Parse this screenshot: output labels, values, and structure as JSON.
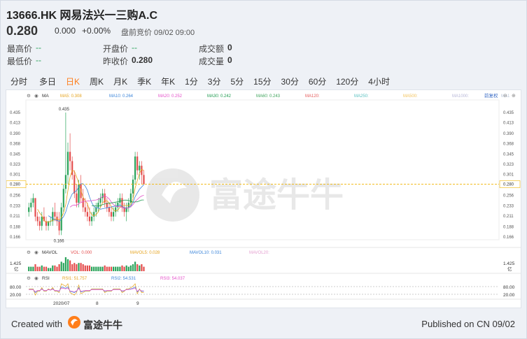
{
  "header": {
    "title": "13666.HK 网易法兴一三购A.C",
    "price": "0.280",
    "change": "0.000",
    "change_pct": "+0.00%",
    "premarket": "盘前竞价 09/02 09:00"
  },
  "stats": [
    {
      "label": "最高价",
      "value": "--"
    },
    {
      "label": "开盘价",
      "value": "--"
    },
    {
      "label": "成交额",
      "value": "0"
    },
    {
      "label": "最低价",
      "value": "--"
    },
    {
      "label": "昨收价",
      "value": "0.280"
    },
    {
      "label": "成交量",
      "value": "0"
    }
  ],
  "tabs": [
    "分时",
    "多日",
    "日K",
    "周K",
    "月K",
    "季K",
    "年K",
    "1分",
    "3分",
    "5分",
    "15分",
    "30分",
    "60分",
    "120分",
    "4小时"
  ],
  "active_tab": "日K",
  "indicators": {
    "main": "MA",
    "ma_items": [
      {
        "label": "MA5: 0.308",
        "color": "#e5a21b"
      },
      {
        "label": "MA10: 0.264",
        "color": "#3a84d9"
      },
      {
        "label": "MA20: 0.252",
        "color": "#e44ec9"
      },
      {
        "label": "MA30: 0.242",
        "color": "#1d9a4e"
      },
      {
        "label": "MA60: 0.243",
        "color": "#3da35a"
      },
      {
        "label": "MA120:",
        "color": "#e45959"
      },
      {
        "label": "MA250:",
        "color": "#58c0c0"
      },
      {
        "label": "MA500:",
        "color": "#f3c25a"
      },
      {
        "label": "MA1000:",
        "color": "#b7b7d7"
      },
      {
        "label": "MA1",
        "color": "#b7c4d7"
      }
    ],
    "adjust": "前复权",
    "vol": "MAVOL",
    "vol_items": [
      {
        "label": "VOL: 0.000",
        "color": "#e44e4e"
      },
      {
        "label": "MAVOL5: 0.028",
        "color": "#e5a21b"
      },
      {
        "label": "MAVOL10: 0.031",
        "color": "#3a84d9"
      },
      {
        "label": "MAVOL20:",
        "color": "#e4a0d0"
      }
    ],
    "rsi": "RSI",
    "rsi_items": [
      {
        "label": "RSI1: 51.757",
        "color": "#e5a21b"
      },
      {
        "label": "RSI2: 54.531",
        "color": "#3a84d9"
      },
      {
        "label": "RSI3: 54.037",
        "color": "#e44ec9"
      }
    ]
  },
  "chart_data": {
    "type": "candlestick",
    "y_ticks": [
      "0.435",
      "0.413",
      "0.390",
      "0.368",
      "0.345",
      "0.323",
      "0.301",
      "0.280",
      "0.256",
      "0.233",
      "0.211",
      "0.188",
      "0.166"
    ],
    "ylim": [
      0.166,
      0.435
    ],
    "last_price": "0.280",
    "high_label": "0.435",
    "low_label": "0.166",
    "x_labels": [
      "2020/07",
      "8",
      "9"
    ],
    "vol_ticks": [
      "1.425",
      "亿"
    ],
    "rsi_ticks": [
      "80.00",
      "20.00"
    ],
    "candles": [
      {
        "o": 0.22,
        "h": 0.24,
        "l": 0.21,
        "c": 0.23
      },
      {
        "o": 0.23,
        "h": 0.25,
        "l": 0.22,
        "c": 0.24
      },
      {
        "o": 0.24,
        "h": 0.26,
        "l": 0.23,
        "c": 0.25
      },
      {
        "o": 0.25,
        "h": 0.25,
        "l": 0.2,
        "c": 0.21
      },
      {
        "o": 0.21,
        "h": 0.22,
        "l": 0.19,
        "c": 0.2
      },
      {
        "o": 0.2,
        "h": 0.21,
        "l": 0.18,
        "c": 0.19
      },
      {
        "o": 0.19,
        "h": 0.22,
        "l": 0.18,
        "c": 0.21
      },
      {
        "o": 0.21,
        "h": 0.23,
        "l": 0.2,
        "c": 0.2
      },
      {
        "o": 0.2,
        "h": 0.21,
        "l": 0.18,
        "c": 0.19
      },
      {
        "o": 0.19,
        "h": 0.2,
        "l": 0.18,
        "c": 0.2
      },
      {
        "o": 0.2,
        "h": 0.21,
        "l": 0.19,
        "c": 0.2
      },
      {
        "o": 0.2,
        "h": 0.23,
        "l": 0.19,
        "c": 0.22
      },
      {
        "o": 0.22,
        "h": 0.24,
        "l": 0.2,
        "c": 0.21
      },
      {
        "o": 0.21,
        "h": 0.22,
        "l": 0.19,
        "c": 0.2
      },
      {
        "o": 0.2,
        "h": 0.22,
        "l": 0.17,
        "c": 0.18
      },
      {
        "o": 0.18,
        "h": 0.24,
        "l": 0.17,
        "c": 0.23
      },
      {
        "o": 0.23,
        "h": 0.28,
        "l": 0.22,
        "c": 0.27
      },
      {
        "o": 0.27,
        "h": 0.435,
        "l": 0.26,
        "c": 0.3
      },
      {
        "o": 0.3,
        "h": 0.37,
        "l": 0.28,
        "c": 0.35
      },
      {
        "o": 0.35,
        "h": 0.39,
        "l": 0.31,
        "c": 0.33
      },
      {
        "o": 0.33,
        "h": 0.34,
        "l": 0.29,
        "c": 0.3
      },
      {
        "o": 0.3,
        "h": 0.31,
        "l": 0.25,
        "c": 0.26
      },
      {
        "o": 0.26,
        "h": 0.28,
        "l": 0.23,
        "c": 0.24
      },
      {
        "o": 0.24,
        "h": 0.29,
        "l": 0.23,
        "c": 0.28
      },
      {
        "o": 0.28,
        "h": 0.3,
        "l": 0.24,
        "c": 0.25
      },
      {
        "o": 0.25,
        "h": 0.27,
        "l": 0.22,
        "c": 0.23
      },
      {
        "o": 0.23,
        "h": 0.25,
        "l": 0.21,
        "c": 0.22
      },
      {
        "o": 0.22,
        "h": 0.24,
        "l": 0.2,
        "c": 0.21
      },
      {
        "o": 0.21,
        "h": 0.23,
        "l": 0.19,
        "c": 0.2
      },
      {
        "o": 0.2,
        "h": 0.22,
        "l": 0.19,
        "c": 0.21
      },
      {
        "o": 0.21,
        "h": 0.23,
        "l": 0.2,
        "c": 0.22
      },
      {
        "o": 0.22,
        "h": 0.24,
        "l": 0.21,
        "c": 0.23
      },
      {
        "o": 0.23,
        "h": 0.25,
        "l": 0.22,
        "c": 0.24
      },
      {
        "o": 0.24,
        "h": 0.26,
        "l": 0.23,
        "c": 0.25
      },
      {
        "o": 0.25,
        "h": 0.27,
        "l": 0.24,
        "c": 0.26
      },
      {
        "o": 0.26,
        "h": 0.27,
        "l": 0.23,
        "c": 0.24
      },
      {
        "o": 0.24,
        "h": 0.25,
        "l": 0.22,
        "c": 0.23
      },
      {
        "o": 0.23,
        "h": 0.24,
        "l": 0.21,
        "c": 0.22
      },
      {
        "o": 0.22,
        "h": 0.23,
        "l": 0.2,
        "c": 0.21
      },
      {
        "o": 0.21,
        "h": 0.23,
        "l": 0.2,
        "c": 0.22
      },
      {
        "o": 0.22,
        "h": 0.24,
        "l": 0.21,
        "c": 0.23
      },
      {
        "o": 0.23,
        "h": 0.25,
        "l": 0.22,
        "c": 0.24
      },
      {
        "o": 0.24,
        "h": 0.26,
        "l": 0.23,
        "c": 0.25
      },
      {
        "o": 0.25,
        "h": 0.26,
        "l": 0.22,
        "c": 0.23
      },
      {
        "o": 0.23,
        "h": 0.24,
        "l": 0.21,
        "c": 0.22
      },
      {
        "o": 0.22,
        "h": 0.24,
        "l": 0.2,
        "c": 0.23
      },
      {
        "o": 0.23,
        "h": 0.25,
        "l": 0.22,
        "c": 0.24
      },
      {
        "o": 0.24,
        "h": 0.27,
        "l": 0.23,
        "c": 0.26
      },
      {
        "o": 0.26,
        "h": 0.3,
        "l": 0.25,
        "c": 0.29
      },
      {
        "o": 0.29,
        "h": 0.35,
        "l": 0.28,
        "c": 0.34
      },
      {
        "o": 0.34,
        "h": 0.35,
        "l": 0.3,
        "c": 0.31
      },
      {
        "o": 0.31,
        "h": 0.33,
        "l": 0.29,
        "c": 0.32
      },
      {
        "o": 0.32,
        "h": 0.33,
        "l": 0.28,
        "c": 0.3
      },
      {
        "o": 0.3,
        "h": 0.31,
        "l": 0.28,
        "c": 0.28
      }
    ]
  },
  "footer": {
    "created": "Created with",
    "brand": "富途牛牛",
    "published": "Published on CN 09/02"
  },
  "watermark": "富途牛牛"
}
